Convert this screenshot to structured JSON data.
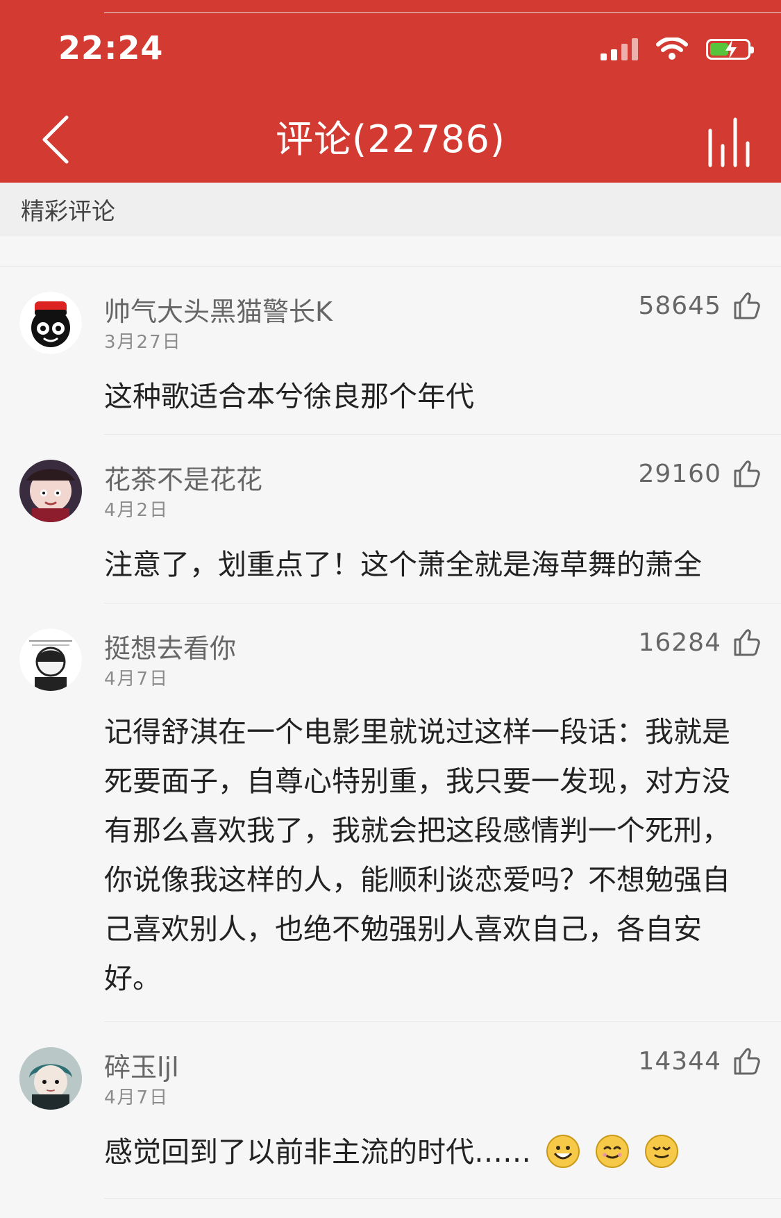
{
  "status_bar": {
    "time": "22:24"
  },
  "nav": {
    "title": "评论(22786)",
    "back_icon": "back-chevron-icon",
    "menu_icon": "bars-icon",
    "header_color": "#d33a31"
  },
  "section": {
    "label": "精彩评论"
  },
  "comments": [
    {
      "user": "帅气大头黑猫警长K",
      "date": "3月27日",
      "likes": "58645",
      "text": "这种歌适合本兮徐良那个年代"
    },
    {
      "user": "花茶不是花花",
      "date": "4月2日",
      "likes": "29160",
      "text": "注意了，划重点了！这个萧全就是海草舞的萧全"
    },
    {
      "user": "挺想去看你",
      "date": "4月7日",
      "likes": "16284",
      "text_lines": [
        "记得舒淇在一个电影里就说过这样一段话：我就是",
        "死要面子，自尊心特别重，我只要一发现，对方没",
        "有那么喜欢我了，我就会把这段感情判一个死刑，",
        "你说像我这样的人，能顺利谈恋爱吗？不想勉强自",
        "己喜欢别人，也绝不勉强别人喜欢自己，各自安",
        "好。"
      ]
    },
    {
      "user": "碎玉ljl",
      "date": "4月7日",
      "likes": "14344",
      "text": "感觉回到了以前非主流的时代……",
      "emojis": [
        "grinning-face-icon",
        "smiling-face-icon",
        "relieved-smile-icon"
      ]
    }
  ]
}
